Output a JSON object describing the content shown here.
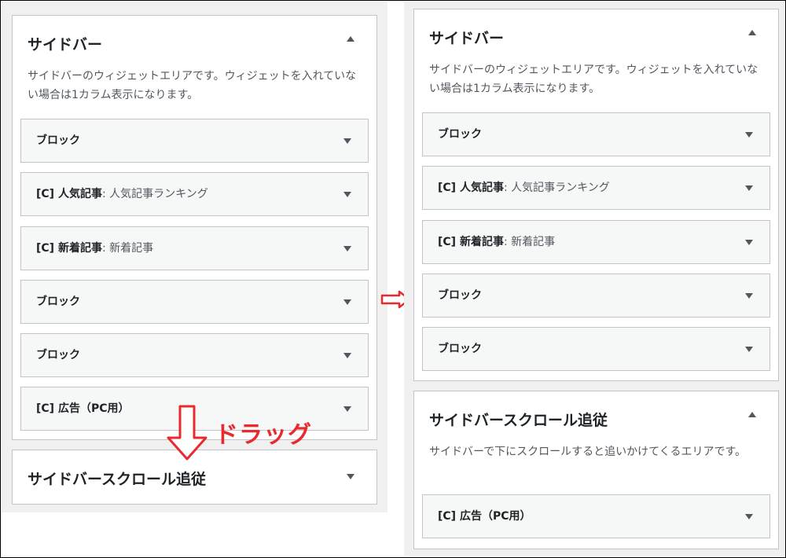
{
  "before": {
    "sidebar": {
      "title": "サイドバー",
      "description": "サイドバーのウィジェットエリアです。ウィジェットを入れていない場合は1カラム表示になります。",
      "widgets": [
        {
          "name": "ブロック",
          "sub": ""
        },
        {
          "name": "[C] 人気記事",
          "sub": ": 人気記事ランキング"
        },
        {
          "name": "[C] 新着記事",
          "sub": ": 新着記事"
        },
        {
          "name": "ブロック",
          "sub": ""
        },
        {
          "name": "ブロック",
          "sub": ""
        },
        {
          "name": "[C] 広告（PC用）",
          "sub": ""
        }
      ]
    },
    "scroll_follow": {
      "title": "サイドバースクロール追従"
    }
  },
  "drag_label": "ドラッグ",
  "after": {
    "sidebar": {
      "title": "サイドバー",
      "description": "サイドバーのウィジェットエリアです。ウィジェットを入れていない場合は1カラム表示になります。",
      "widgets": [
        {
          "name": "ブロック",
          "sub": ""
        },
        {
          "name": "[C] 人気記事",
          "sub": ": 人気記事ランキング"
        },
        {
          "name": "[C] 新着記事",
          "sub": ": 新着記事"
        },
        {
          "name": "ブロック",
          "sub": ""
        },
        {
          "name": "ブロック",
          "sub": ""
        }
      ]
    },
    "scroll_follow": {
      "title": "サイドバースクロール追従",
      "description": "サイドバーで下にスクロールすると追いかけてくるエリアです。",
      "widgets": [
        {
          "name": "[C] 広告（PC用）",
          "sub": ""
        }
      ]
    }
  },
  "colors": {
    "annotation_red": "#e8292e",
    "panel_bg": "#f0f0f1",
    "widget_bg": "#f6f7f7",
    "border": "#c3c4c7"
  },
  "icons": {
    "collapse": "triangle-up-icon",
    "expand": "triangle-down-icon",
    "drag": "arrow-down-outline-icon",
    "transition": "arrow-right-outline-icon"
  }
}
